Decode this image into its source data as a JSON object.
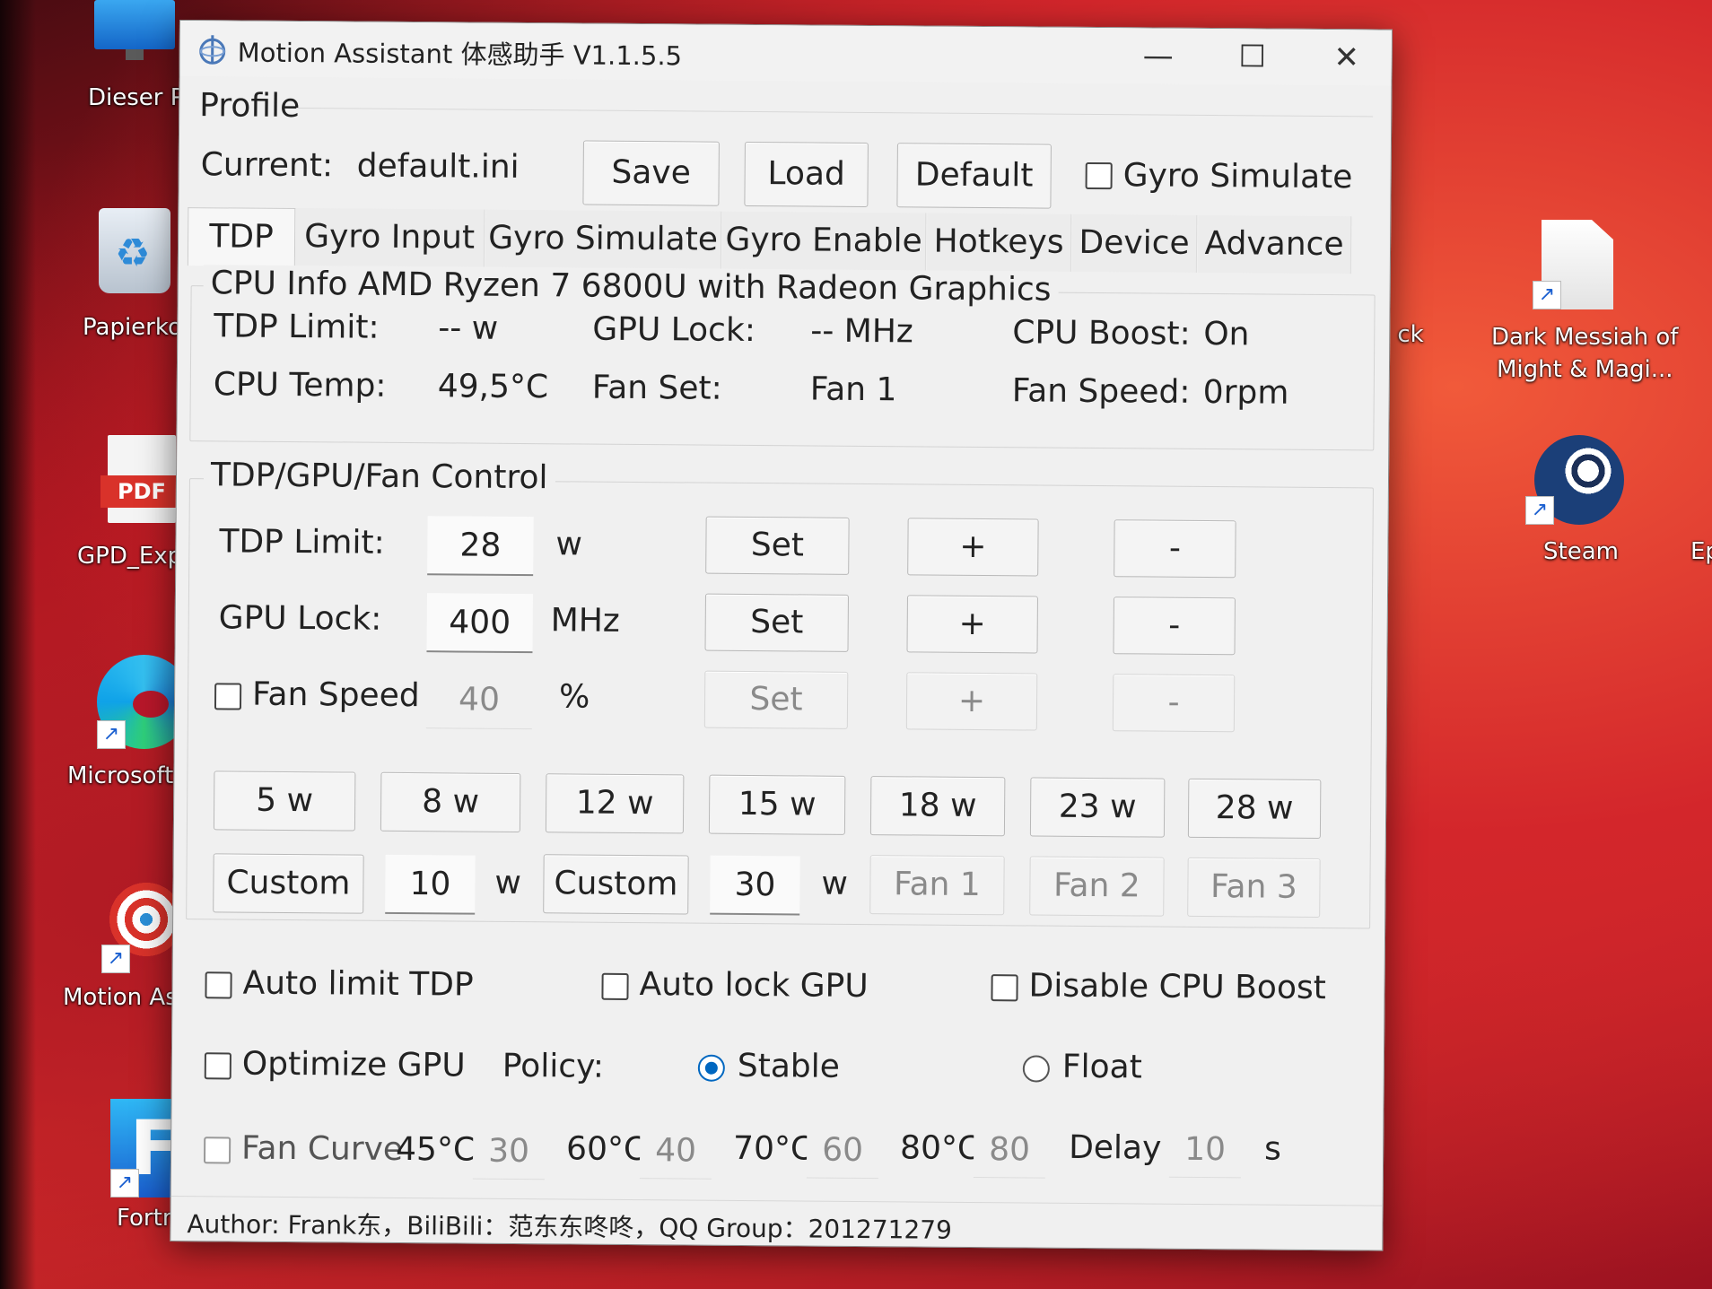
{
  "desktop": {
    "icons": [
      {
        "label": "Dieser P"
      },
      {
        "label": "Papierko"
      },
      {
        "label": "GPD_Expl",
        "badge": "PDF"
      },
      {
        "label": "Microsoft E"
      },
      {
        "label": "Motion Ass"
      },
      {
        "label": "Fortnite",
        "glyph": "F"
      },
      {
        "label_line1": "Dark Messiah of",
        "label_line2": "Might & Magi..."
      },
      {
        "label": "Steam"
      },
      {
        "label": "Ep"
      },
      {
        "label": "ck"
      }
    ]
  },
  "window": {
    "title": "Motion Assistant 体感助手 V1.1.5.5",
    "controls": {
      "minimize": "—",
      "maximize": "☐",
      "close": "✕"
    }
  },
  "profile": {
    "section_title": "Profile",
    "current_label": "Current:",
    "current_value": "default.ini",
    "save": "Save",
    "load": "Load",
    "default": "Default",
    "gyro_simulate": "Gyro Simulate"
  },
  "tabs": [
    "TDP",
    "Gyro Input",
    "Gyro Simulate",
    "Gyro Enable",
    "Hotkeys",
    "Device",
    "Advance"
  ],
  "cpu_info": {
    "title": "CPU Info  AMD Ryzen 7 6800U with Radeon Graphics",
    "tdp_limit_label": "TDP Limit:",
    "tdp_limit_value": "-- w",
    "gpu_lock_label": "GPU Lock:",
    "gpu_lock_value": "-- MHz",
    "cpu_boost_label": "CPU Boost:",
    "cpu_boost_value": "On",
    "cpu_temp_label": "CPU Temp:",
    "cpu_temp_value": "49,5°C",
    "fan_set_label": "Fan Set:",
    "fan_set_value": "Fan 1",
    "fan_speed_label": "Fan Speed:",
    "fan_speed_value": "0rpm"
  },
  "control": {
    "title": "TDP/GPU/Fan Control",
    "tdp_label": "TDP Limit:",
    "tdp_value": "28",
    "tdp_unit": "w",
    "gpu_label": "GPU Lock:",
    "gpu_value": "400",
    "gpu_unit": "MHz",
    "fan_label": "Fan Speed",
    "fan_value": "40",
    "fan_unit": "%",
    "set": "Set",
    "plus": "+",
    "minus": "-",
    "presets": [
      "5 w",
      "8 w",
      "12 w",
      "15 w",
      "18 w",
      "23 w",
      "28 w"
    ],
    "custom": "Custom",
    "custom1_value": "10",
    "custom2_value": "30",
    "custom_unit": "w",
    "fans": [
      "Fan 1",
      "Fan 2",
      "Fan 3"
    ]
  },
  "options": {
    "auto_limit_tdp": "Auto limit TDP",
    "auto_lock_gpu": "Auto lock GPU",
    "disable_cpu_boost": "Disable CPU Boost",
    "optimize_gpu": "Optimize GPU",
    "policy_label": "Policy:",
    "stable": "Stable",
    "float": "Float",
    "fan_curve": "Fan Curve",
    "t1": "45°C",
    "v1": "30",
    "t2": "60°C",
    "v2": "40",
    "t3": "70°C",
    "v3": "60",
    "t4": "80°C",
    "v4": "80",
    "delay_label": "Delay",
    "delay_value": "10",
    "delay_unit": "s"
  },
  "footer": {
    "author": "Author:  Frank东，BiliBili：范东东咚咚，QQ Group：201271279"
  }
}
